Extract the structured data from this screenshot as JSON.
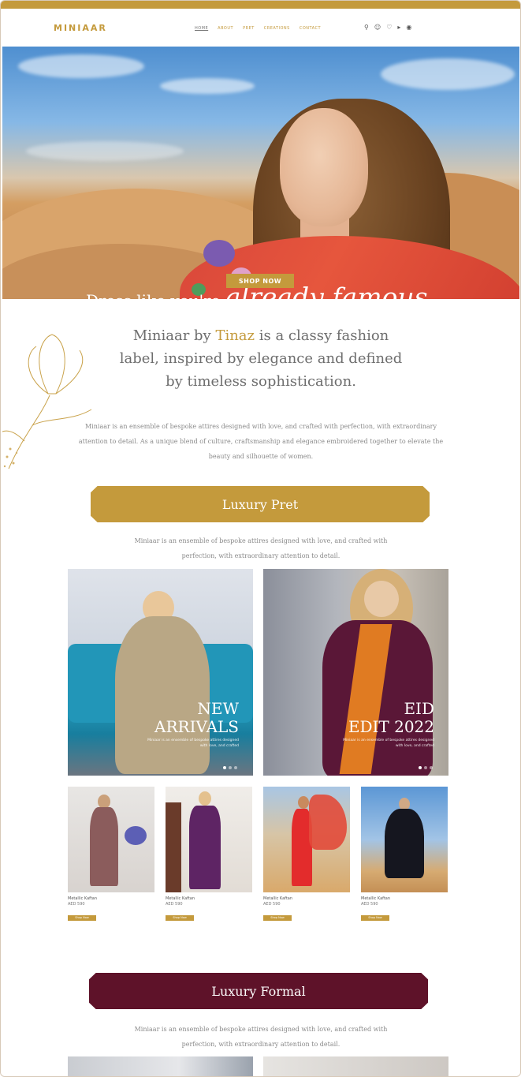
{
  "header": {
    "logo": "MINIAAR",
    "nav": [
      "HOME",
      "ABOUT",
      "PRET",
      "CREATIONS",
      "CONTACT"
    ],
    "icons": [
      "search-icon",
      "user-icon",
      "heart-icon",
      "cart-icon",
      "bag-icon"
    ]
  },
  "hero": {
    "headline_plain": "Dress like you're ",
    "headline_script": "already famous.",
    "cta": "SHOP NOW"
  },
  "intro": {
    "heading_pre": "Miniaar by ",
    "heading_accent": "Tinaz",
    "heading_post": " is a classy fashion label, inspired by elegance and defined by timeless sophistication.",
    "body": "Miniaar is an ensemble of bespoke attires designed with love, and crafted with perfection, with extraordinary attention to detail. As a unique blend of culture, craftsmanship and elegance embroidered together to elevate the beauty and silhouette of women."
  },
  "luxury_pret": {
    "title": "Luxury Pret",
    "desc": "Miniaar is an ensemble of bespoke attires designed with love, and crafted with perfection, with extraordinary attention to detail."
  },
  "features": [
    {
      "line1": "NEW",
      "line2": "ARRIVALS",
      "sub": "Miniaar is an ensemble of bespoke attires designed with love, and crafted"
    },
    {
      "line1": "EID",
      "line2": "EDIT 2022",
      "sub": "Miniaar is an ensemble of bespoke attires designed with love, and crafted"
    }
  ],
  "products": [
    {
      "name": "Metallic Kaftan",
      "price": "AED 590",
      "button": "Shop Now"
    },
    {
      "name": "Metallic Kaftan",
      "price": "AED 590",
      "button": "Shop Now"
    },
    {
      "name": "Metallic Kaftan",
      "price": "AED 590",
      "button": "Shop Now"
    },
    {
      "name": "Metallic Kaftan",
      "price": "AED 590",
      "button": "Shop Now"
    }
  ],
  "luxury_formal": {
    "title": "Luxury Formal",
    "desc": "Miniaar is an ensemble of bespoke attires designed with love, and crafted with perfection, with extraordinary attention to detail."
  },
  "colors": {
    "gold": "#c49a3c",
    "maroon": "#5e1229"
  }
}
